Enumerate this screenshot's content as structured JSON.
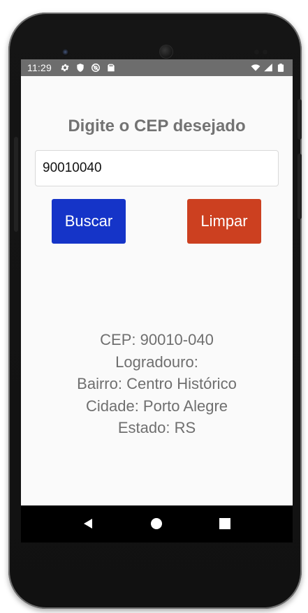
{
  "status_bar": {
    "time": "11:29",
    "left_icons": [
      "gear-icon",
      "shield-icon",
      "at-sign-icon",
      "sd-card-icon"
    ],
    "right_icons": [
      "wifi-icon",
      "signal-icon",
      "battery-icon"
    ]
  },
  "app": {
    "title": "Digite o CEP desejado",
    "input": {
      "value": "90010040",
      "placeholder": ""
    },
    "buttons": {
      "search_label": "Buscar",
      "clear_label": "Limpar"
    },
    "result": {
      "cep": "CEP: 90010-040",
      "street": "Logradouro:",
      "district": "Bairro: Centro Histórico",
      "city": "Cidade: Porto Alegre",
      "state": "Estado: RS"
    }
  },
  "navigation": {
    "icons": [
      "back-icon",
      "home-icon",
      "recent-apps-icon"
    ]
  },
  "colors": {
    "search_button": "#1534c8",
    "clear_button": "#cc4020",
    "status_bar": "#6d6d6d",
    "background": "#fafafa",
    "text": "#6f6f6f"
  }
}
